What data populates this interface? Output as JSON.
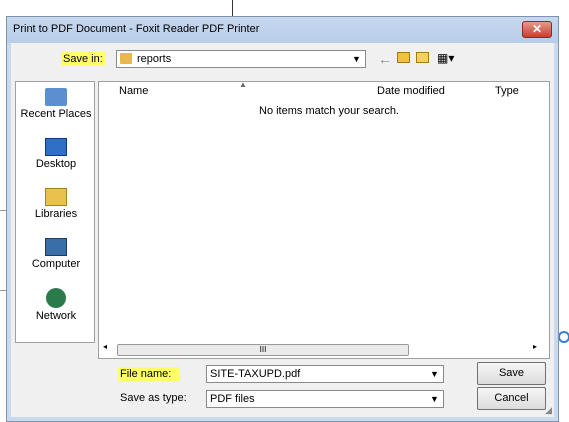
{
  "dialog": {
    "title": "Print to PDF Document - Foxit Reader PDF Printer",
    "close_glyph": "✕"
  },
  "save_in": {
    "label": "Save in:",
    "value": "reports",
    "folder_icon": "folder-icon"
  },
  "toolbar": {
    "back_icon": "back-arrow-icon",
    "up_icon": "up-folder-icon",
    "new_folder_icon": "new-folder-icon",
    "view_icon": "view-menu-icon"
  },
  "places": [
    {
      "label": "Recent Places",
      "icon": "recent-places-icon"
    },
    {
      "label": "Desktop",
      "icon": "desktop-icon"
    },
    {
      "label": "Libraries",
      "icon": "libraries-icon"
    },
    {
      "label": "Computer",
      "icon": "computer-icon"
    },
    {
      "label": "Network",
      "icon": "network-icon"
    }
  ],
  "file_list": {
    "columns": [
      "Name",
      "Date modified",
      "Type"
    ],
    "empty_message": "No items match your search.",
    "scroll_grip": "III"
  },
  "file_name": {
    "label": "File name:",
    "value": "SITE-TAXUPD.pdf"
  },
  "save_as_type": {
    "label": "Save as type:",
    "value": "PDF files"
  },
  "buttons": {
    "save": "Save",
    "cancel": "Cancel"
  },
  "colors": {
    "highlight": "#ffff66",
    "title_bg": "#c7d8ee",
    "close_red": "#c6402f"
  }
}
